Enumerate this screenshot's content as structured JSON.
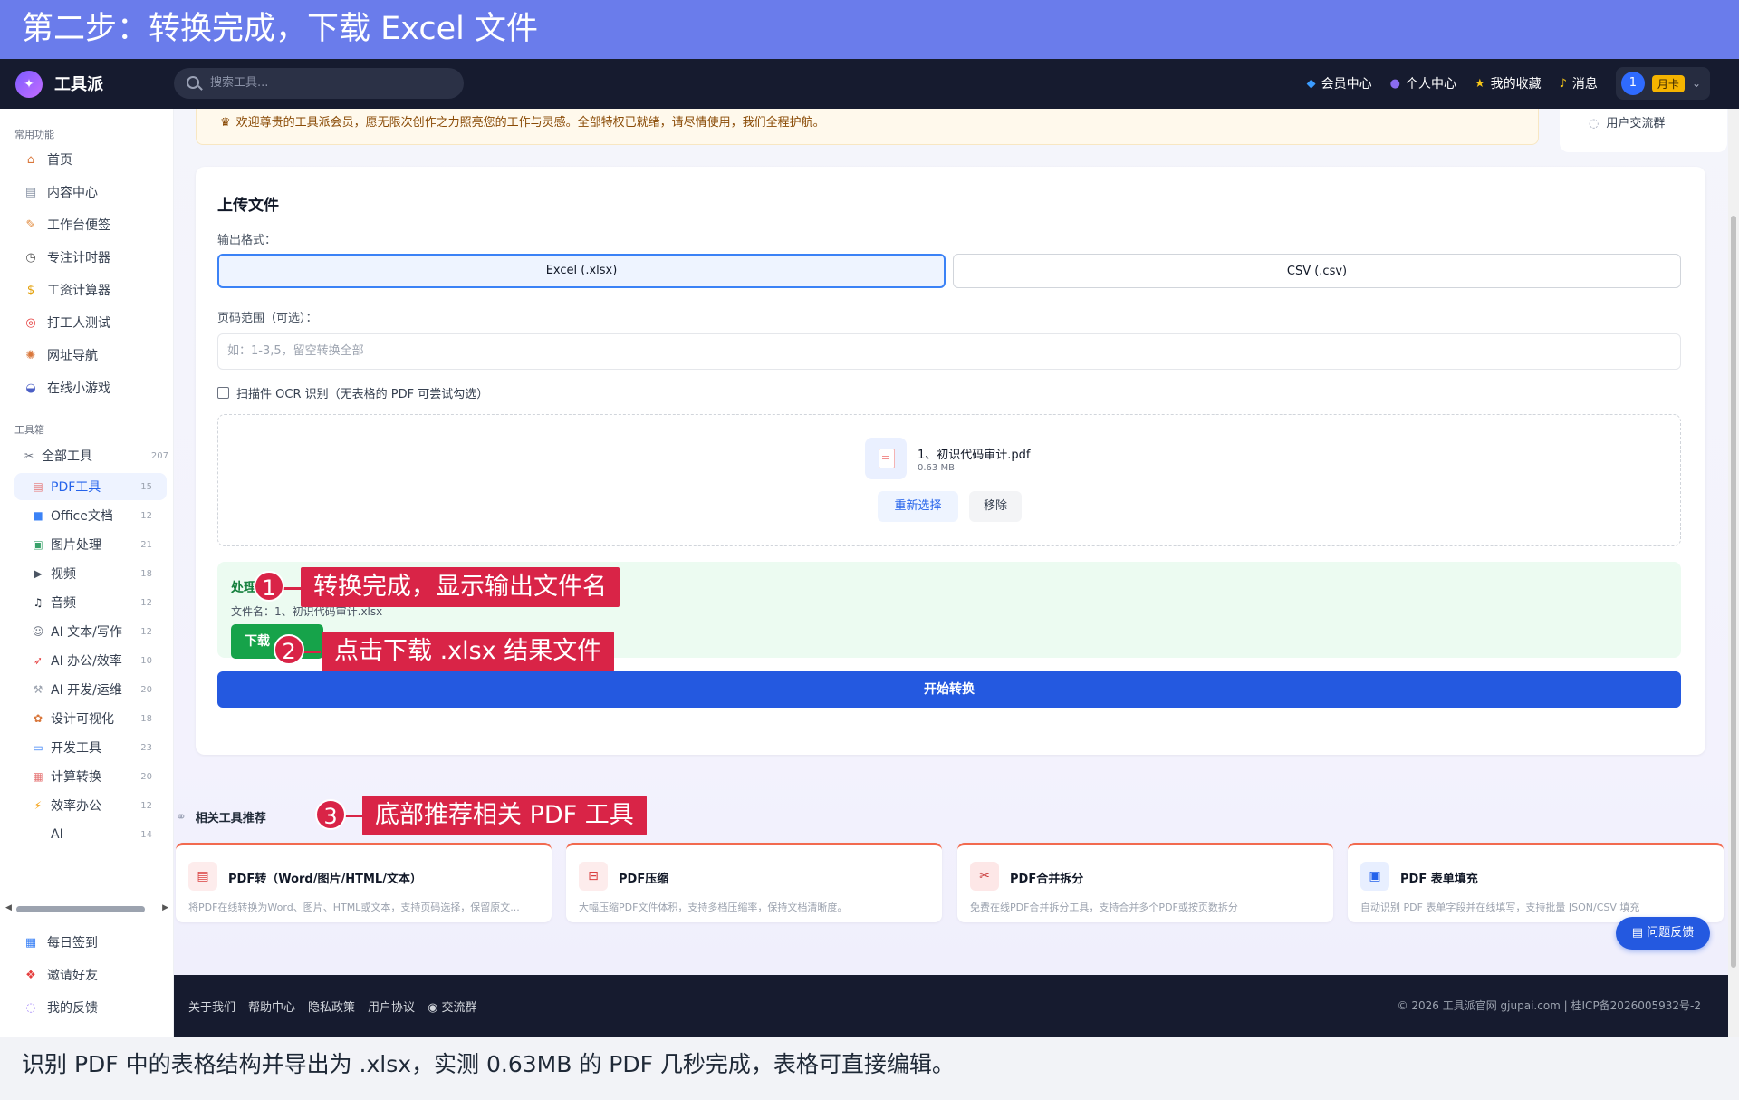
{
  "banner": {
    "title": "第二步：转换完成，下载 Excel 文件"
  },
  "nav": {
    "logo": "工具派",
    "search_placeholder": "搜索工具...",
    "items": [
      {
        "icon": "diamond-icon",
        "label": "会员中心"
      },
      {
        "icon": "user-icon",
        "label": "个人中心"
      },
      {
        "icon": "star-icon",
        "label": "我的收藏"
      },
      {
        "icon": "bell-icon",
        "label": "消息"
      }
    ],
    "user_avatar": "1",
    "user_badge": "月卡"
  },
  "sidebar": {
    "section_common": "常用功能",
    "common": [
      {
        "icon": "home-icon",
        "label": "首页"
      },
      {
        "icon": "content-icon",
        "label": "内容中心"
      },
      {
        "icon": "notes-icon",
        "label": "工作台便签"
      },
      {
        "icon": "timer-icon",
        "label": "专注计时器"
      },
      {
        "icon": "salary-icon",
        "label": "工资计算器"
      },
      {
        "icon": "target-icon",
        "label": "打工人测试"
      },
      {
        "icon": "compass-icon",
        "label": "网址导航"
      },
      {
        "icon": "gamepad-icon",
        "label": "在线小游戏"
      }
    ],
    "section_tools": "工具箱",
    "all_tools": {
      "label": "全部工具",
      "count": "207"
    },
    "tools": [
      {
        "label": "PDF工具",
        "count": "15",
        "active": true
      },
      {
        "label": "Office文档",
        "count": "12"
      },
      {
        "label": "图片处理",
        "count": "21"
      },
      {
        "label": "视频",
        "count": "18"
      },
      {
        "label": "音频",
        "count": "12"
      },
      {
        "label": "AI 文本/写作",
        "count": "12"
      },
      {
        "label": "AI 办公/效率",
        "count": "10"
      },
      {
        "label": "AI 开发/运维",
        "count": "20"
      },
      {
        "label": "设计可视化",
        "count": "18"
      },
      {
        "label": "开发工具",
        "count": "23"
      },
      {
        "label": "计算转换",
        "count": "20"
      },
      {
        "label": "效率办公",
        "count": "12"
      },
      {
        "label": "AI",
        "count": "14"
      }
    ],
    "bottom": [
      {
        "icon": "calendar-icon",
        "label": "每日签到"
      },
      {
        "icon": "gift-icon",
        "label": "邀请好友"
      },
      {
        "icon": "chat-icon",
        "label": "我的反馈"
      }
    ]
  },
  "welcome": {
    "text": "欢迎尊贵的工具派会员，愿无限次创作之力照亮您的工作与灵感。全部特权已就绪，请尽情使用，我们全程护航。",
    "community": "用户交流群"
  },
  "upload": {
    "title": "上传文件",
    "format_label": "输出格式：",
    "formats": [
      "Excel (.xlsx)",
      "CSV (.csv)"
    ],
    "range_label": "页码范围（可选）：",
    "range_placeholder": "如：1-3,5，留空转换全部",
    "ocr_label": "扫描件 OCR 识别（无表格的 PDF 可尝试勾选）",
    "file_name": "1、初识代码审计.pdf",
    "file_size": "0.63 MB",
    "reselect": "重新选择",
    "remove": "移除",
    "result_title": "处理",
    "result_file": "文件名：1、初识代码审计.xlsx",
    "download": "下载",
    "start": "开始转换"
  },
  "related": {
    "title": "相关工具推荐",
    "tools": [
      {
        "name": "PDF转（Word/图片/HTML/文本）",
        "desc": "将PDF在线转换为Word、图片、HTML或文本，支持页码选择，保留原文..."
      },
      {
        "name": "PDF压缩",
        "desc": "大幅压缩PDF文件体积，支持多档压缩率，保持文档清晰度。"
      },
      {
        "name": "PDF合并拆分",
        "desc": "免费在线PDF合并拆分工具，支持合并多个PDF或按页数拆分"
      },
      {
        "name": "PDF 表单填充",
        "desc": "自动识别 PDF 表单字段并在线填写，支持批量 JSON/CSV 填充"
      }
    ]
  },
  "feedback": "问题反馈",
  "footer": {
    "links": [
      "关于我们",
      "帮助中心",
      "隐私政策",
      "用户协议",
      "交流群"
    ],
    "copyright": "© 2026 工具派官网 gjupai.com | 桂ICP备2026005932号-2"
  },
  "callouts": [
    {
      "num": "1",
      "text": "转换完成，显示输出文件名"
    },
    {
      "num": "2",
      "text": "点击下载 .xlsx 结果文件"
    },
    {
      "num": "3",
      "text": "底部推荐相关 PDF 工具"
    }
  ],
  "caption": "识别 PDF 中的表格结构并导出为 .xlsx，实测 0.63MB 的 PDF 几秒完成，表格可直接编辑。"
}
